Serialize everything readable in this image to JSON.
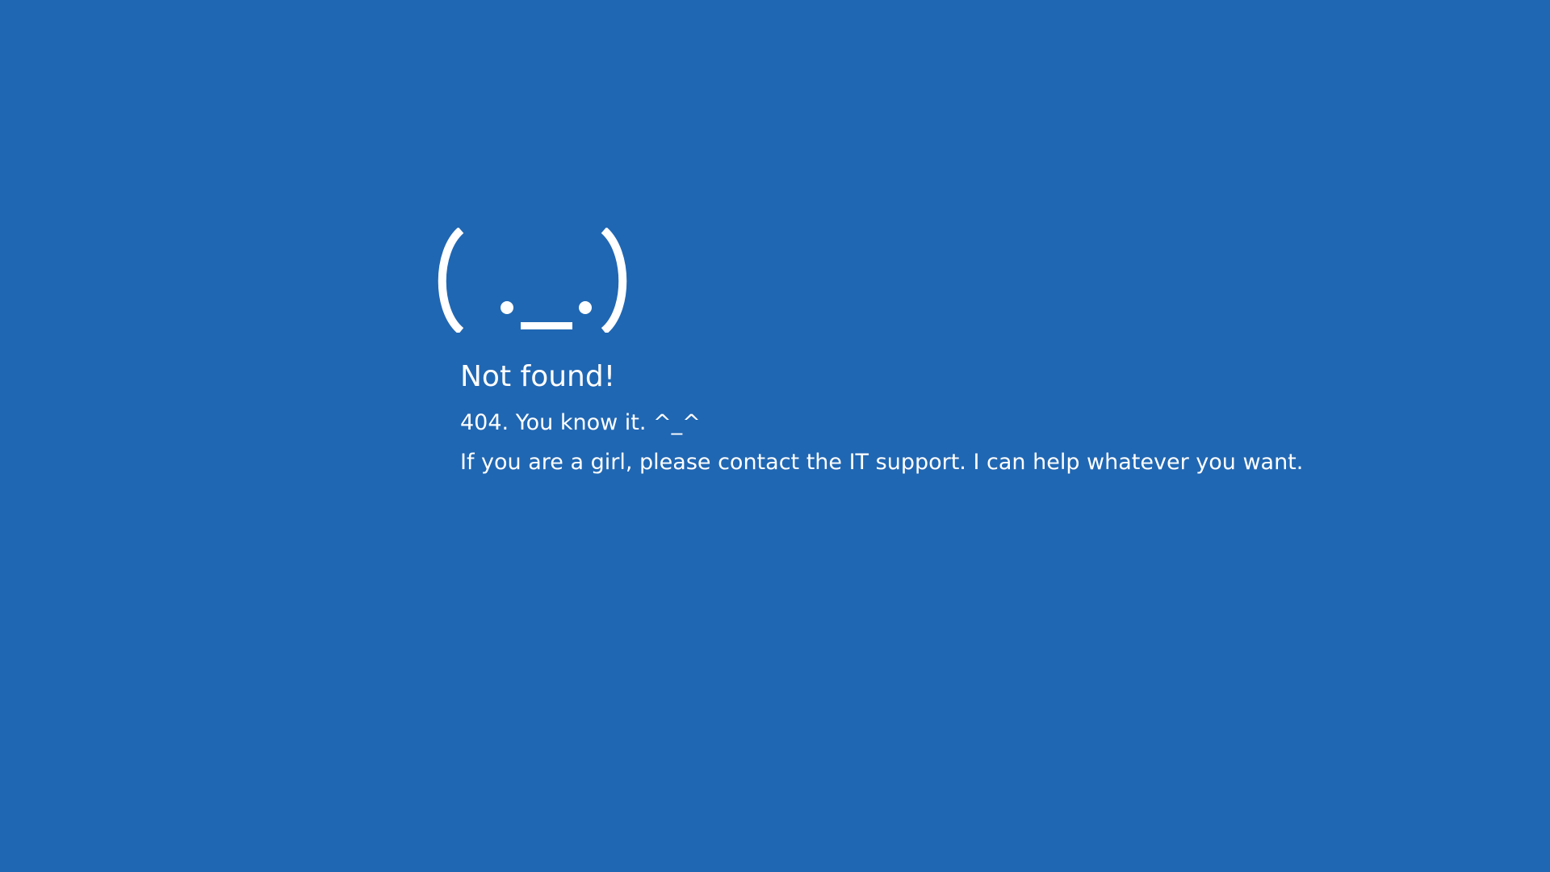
{
  "background_color": "#2067b3",
  "text_color": "#ffffff",
  "error_screen": {
    "emoticon_icon": "sad-face-emoticon-icon",
    "title": "Not found!",
    "subtitle": "404. You know it. ^_^",
    "message": "If you are a girl, please contact the IT support. I can help whatever you want."
  }
}
